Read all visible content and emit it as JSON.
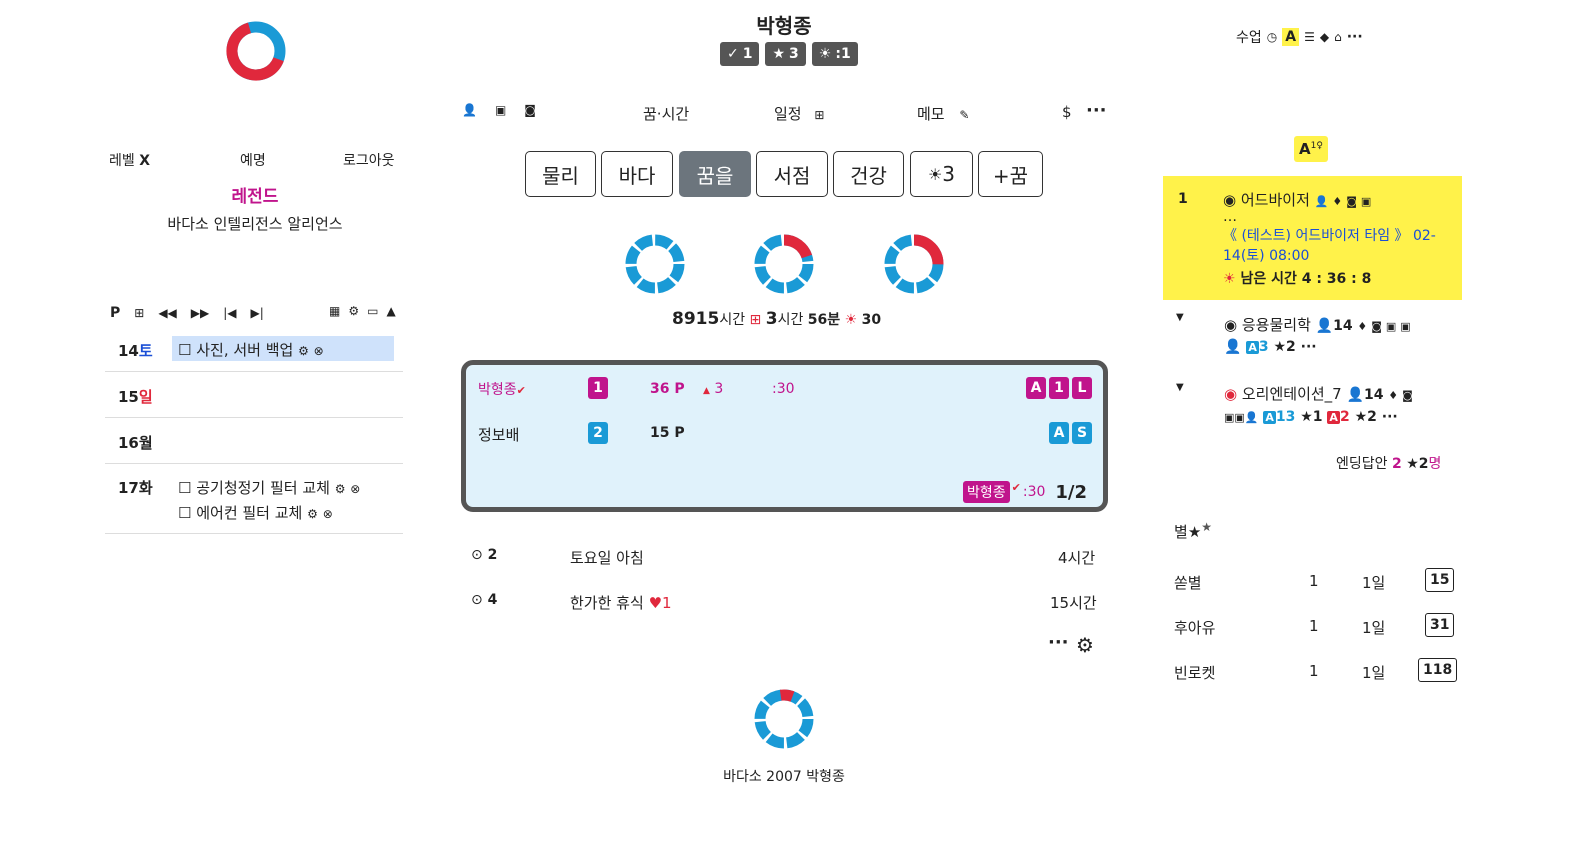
{
  "header": {
    "user_name": "박형종",
    "badges": [
      {
        "icon": "check-icon",
        "value": "1"
      },
      {
        "icon": "star-icon",
        "value": "3"
      },
      {
        "icon": "spark-icon",
        "value": ":1"
      }
    ]
  },
  "left": {
    "level_label": "레벨",
    "level_value": "X",
    "nickname_label": "예명",
    "logout_label": "로그아웃",
    "rank": "레전드",
    "org": "바다소 인텔리전스 알리언스",
    "calendar_p": "P",
    "days": [
      {
        "num": "14",
        "weekday": "토",
        "tasks": [
          "☐ 사진, 서버 백업"
        ]
      },
      {
        "num": "15",
        "weekday": "일",
        "tasks": []
      },
      {
        "num": "16",
        "weekday": "월",
        "tasks": []
      },
      {
        "num": "17",
        "weekday": "화",
        "tasks": [
          "☐ 공기청정기 필터 교체",
          "☐ 에어컨 필터 교체"
        ]
      }
    ]
  },
  "center": {
    "menu": {
      "dream_time": "꿈·시간",
      "schedule": "일정",
      "memo": "메모",
      "dollar": "$",
      "more": "···"
    },
    "tabs": [
      "물리",
      "바다",
      "꿈을",
      "서점",
      "건강",
      "3",
      "+꿈"
    ],
    "active_tab": 2,
    "stats": {
      "hours": "8915",
      "hours_unit": "시간",
      "h2": "3",
      "h2_unit": "시간",
      "minutes": "56분",
      "sparks": "30"
    },
    "board": {
      "rows": [
        {
          "name": "박형종",
          "num": "1",
          "points": "36 P",
          "up": "3",
          "time": ":30",
          "tags": [
            "A",
            "1",
            "L"
          ]
        },
        {
          "name": "정보배",
          "num": "2",
          "points": "15 P",
          "up": "",
          "time": "",
          "tags": [
            "A",
            "S"
          ]
        }
      ],
      "footer_name": "박형종",
      "footer_time": ":30",
      "footer_page": "1/2"
    },
    "list": [
      {
        "num": "2",
        "title": "토요일 아침",
        "hearts": "",
        "dur": "4시간"
      },
      {
        "num": "4",
        "title": "한가한 휴식",
        "hearts": "1",
        "dur": "15시간"
      }
    ],
    "more": "···",
    "footer": "바다소 2007 박형종"
  },
  "right": {
    "top_label": "수업",
    "top_badge": "A",
    "more": "···",
    "a_badge": "A",
    "a_sup": "1",
    "items": [
      {
        "num": "1",
        "title": "어드바이저",
        "extra": "…",
        "sub": "《 (테스트) 어드바이저 타임 》 02-14(토) 08:00",
        "remaining": "남은 시간 4 : 36 : 8"
      },
      {
        "title": "응용물리학",
        "people": "14",
        "a_count": "3",
        "stars": "2",
        "more": "···"
      },
      {
        "title": "오리엔테이션_7",
        "people": "14",
        "a_count": "13",
        "stars1": "1",
        "a2": "2",
        "stars2": "2",
        "more": "···"
      }
    ],
    "ending": {
      "label": "엔딩답안",
      "count": "2",
      "stars": "2",
      "unit": "명"
    },
    "stars_title": "별",
    "table": [
      {
        "name": "쏟별",
        "a": "1",
        "b": "1일",
        "c": "15"
      },
      {
        "name": "후아유",
        "a": "1",
        "b": "1일",
        "c": "31"
      },
      {
        "name": "빈로켓",
        "a": "1",
        "b": "1일",
        "c": "118"
      }
    ]
  },
  "colors": {
    "donut_blue": "#1a9ad6",
    "donut_red": "#e0283c",
    "accent_pink": "#c0148c",
    "highlight_yellow": "#fff24a"
  }
}
